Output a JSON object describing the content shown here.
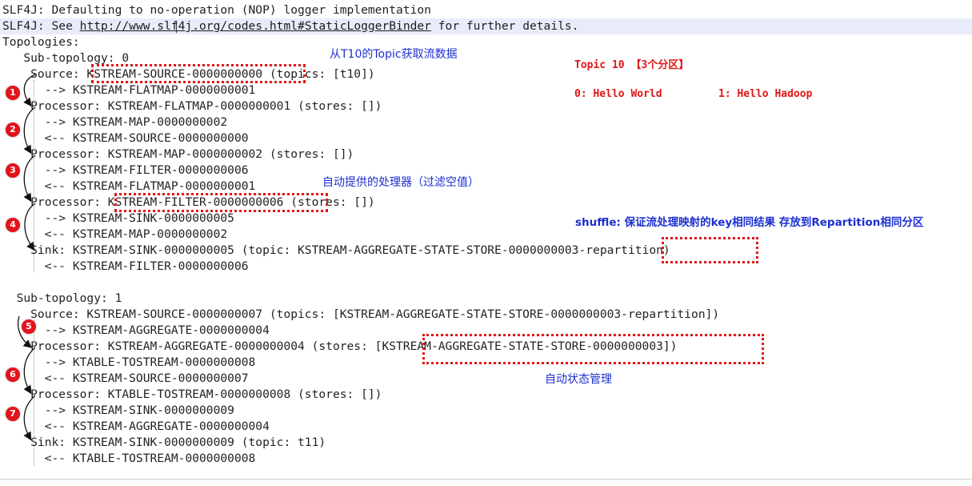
{
  "console": {
    "lines": [
      "SLF4J: Defaulting to no-operation (NOP) logger implementation",
      "SLF4J: See ",
      "Topologies:",
      "   Sub-topology: 0",
      "    Source: KSTREAM-SOURCE-0000000000 (topics: [t10])",
      "      --> KSTREAM-FLATMAP-0000000001",
      "    Processor: KSTREAM-FLATMAP-0000000001 (stores: [])",
      "      --> KSTREAM-MAP-0000000002",
      "      <-- KSTREAM-SOURCE-0000000000",
      "    Processor: KSTREAM-MAP-0000000002 (stores: [])",
      "      --> KSTREAM-FILTER-0000000006",
      "      <-- KSTREAM-FLATMAP-0000000001",
      "    Processor: KSTREAM-FILTER-0000000006 (stores: [])",
      "      --> KSTREAM-SINK-0000000005",
      "      <-- KSTREAM-MAP-0000000002",
      "    Sink: KSTREAM-SINK-0000000005 (topic: KSTREAM-AGGREGATE-STATE-STORE-0000000003-repartition)",
      "      <-- KSTREAM-FILTER-0000000006",
      "",
      "  Sub-topology: 1",
      "    Source: KSTREAM-SOURCE-0000000007 (topics: [KSTREAM-AGGREGATE-STATE-STORE-0000000003-repartition])",
      "      --> KSTREAM-AGGREGATE-0000000004",
      "    Processor: KSTREAM-AGGREGATE-0000000004 (stores: [KSTREAM-AGGREGATE-STATE-STORE-0000000003])",
      "      --> KTABLE-TOSTREAM-0000000008",
      "      <-- KSTREAM-SOURCE-0000000007",
      "    Processor: KTABLE-TOSTREAM-0000000008 (stores: [])",
      "      --> KSTREAM-SINK-0000000009",
      "      <-- KSTREAM-AGGREGATE-0000000004",
      "    Sink: KSTREAM-SINK-0000000009 (topic: t11)",
      "      <-- KTABLE-TOSTREAM-0000000008"
    ],
    "link_text": "http://www.slf4j.org/codes.html#StaticLoggerBinder",
    "link_suffix": " for further details."
  },
  "annotations": {
    "topic_source_note": "从T10的Topic获取流数据",
    "auto_processor_note": "自动提供的处理器（过滤空值）",
    "shuffle_note": "shuffle: 保证流处理映射的key相同结果 存放到Repartition相同分区",
    "state_note": "自动状态管理",
    "topic_title": "Topic 10 【3个分区】",
    "partition_0": "0: Hello World",
    "partition_1": "1: Hello Hadoop"
  },
  "badges": [
    "1",
    "2",
    "3",
    "4",
    "5",
    "6",
    "7"
  ],
  "colors": {
    "annotation_blue": "#1c2fd0",
    "annotation_red": "#e01515",
    "badge_red": "#e3131b",
    "highlight_line": "#e8ecfa"
  }
}
